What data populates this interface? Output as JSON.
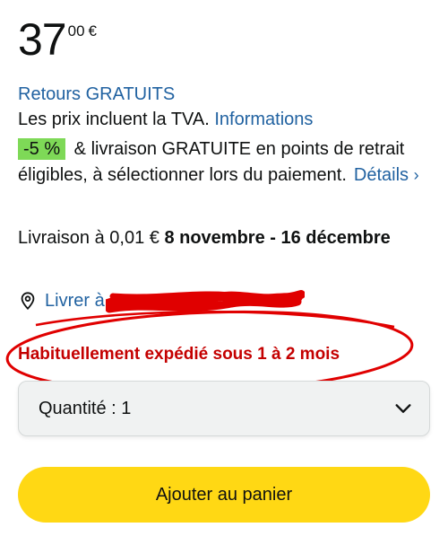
{
  "price": {
    "whole": "37",
    "fraction": "00",
    "currency": "€"
  },
  "returns_label": "Retours GRATUITS",
  "vat": {
    "text": "Les prix incluent la TVA. ",
    "link": "Informations"
  },
  "promo": {
    "badge": "-5 %",
    "text": " & livraison GRATUITE en points de retrait éligibles, à sélectionner lors du paiement.",
    "details_link": "Détails",
    "details_chevron": "›"
  },
  "delivery": {
    "prefix": "Livraison à 0,01 € ",
    "dates": "8 novembre - 16 décembre"
  },
  "location": {
    "icon": "location-pin-icon",
    "link": "Livrer à"
  },
  "shipping_notice": "Habituellement expédié sous 1 à 2 mois",
  "quantity": {
    "label": "Quantité : 1",
    "icon": "chevron-down-icon"
  },
  "add_to_cart": "Ajouter au panier",
  "colors": {
    "link": "#2162a1",
    "badge": "#7ed957",
    "shipping_text": "#c40000",
    "annotation": "#e00000",
    "cart_button": "#ffd814"
  }
}
